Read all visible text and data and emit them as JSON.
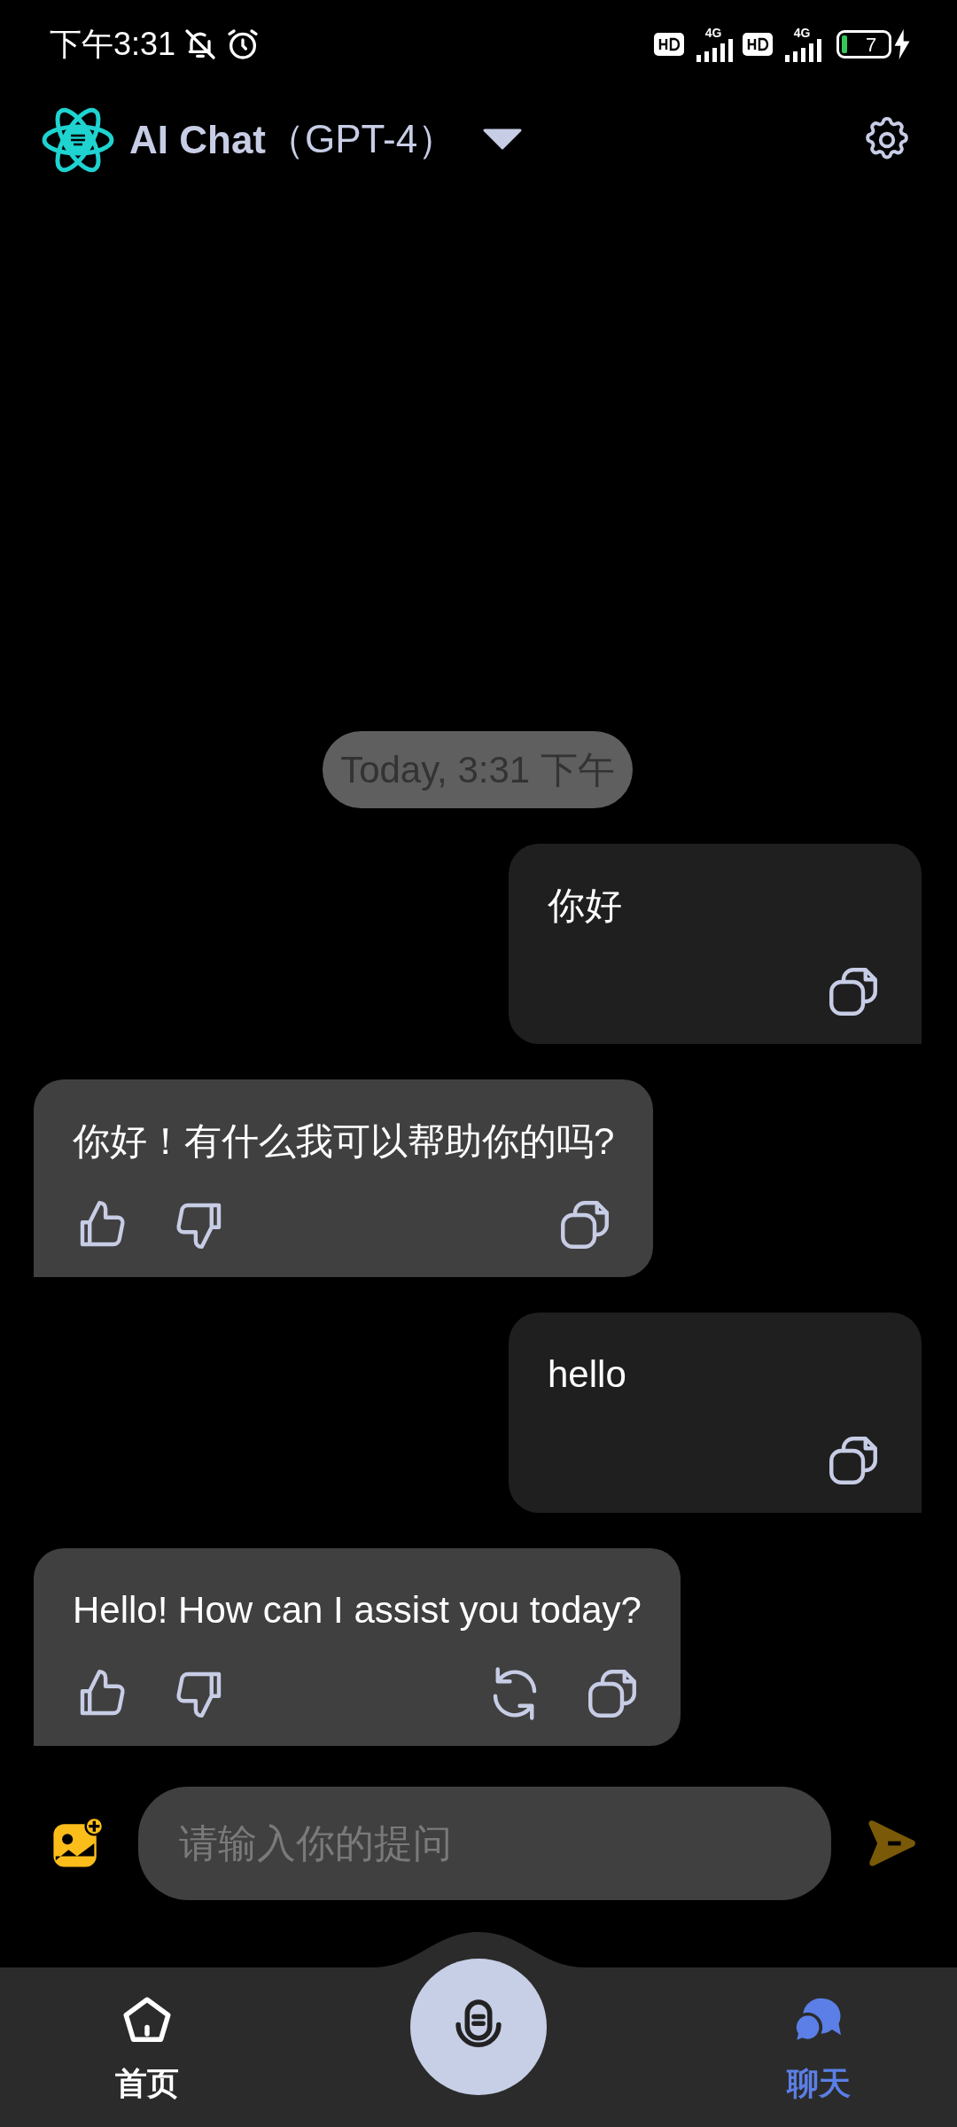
{
  "status_bar": {
    "time": "下午3:31",
    "network_1": "4G",
    "network_2": "4G",
    "battery": "7"
  },
  "header": {
    "title": "AI Chat",
    "model": "（GPT-4）"
  },
  "timestamp": "Today, 3:31 下午",
  "messages": [
    {
      "kind": "user",
      "text": "你好"
    },
    {
      "kind": "assistant",
      "text": "你好！有什么我可以帮助你的吗?",
      "regenerate": false
    },
    {
      "kind": "user",
      "text": "hello"
    },
    {
      "kind": "assistant",
      "text": "Hello! How can I assist you today?",
      "regenerate": true
    }
  ],
  "composer": {
    "placeholder": "请输入你的提问",
    "send_enabled": false
  },
  "nav": [
    {
      "kind": "home",
      "label": "首页",
      "selected": false
    },
    {
      "kind": "chat",
      "label": "聊天",
      "selected": true
    }
  ]
}
